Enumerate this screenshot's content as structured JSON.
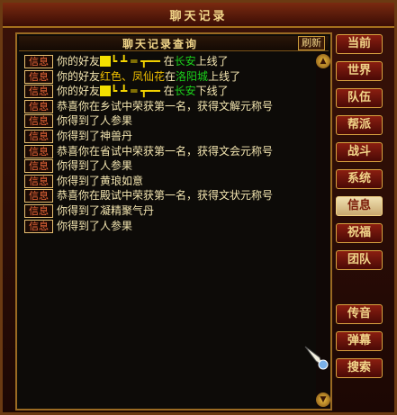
{
  "window": {
    "title": "聊天记录"
  },
  "query": {
    "title": "聊天记录查询",
    "refresh_label": "刷新"
  },
  "colors": {
    "accent": "#d8a240",
    "tag": "#f06a3a",
    "text": "#f3e5b0",
    "place": "#1bd11b",
    "name": "#f0c000"
  },
  "messages": [
    {
      "tag": "信息",
      "parts": [
        {
          "t": "你的好友"
        },
        {
          "icon": "name-glyph-icon"
        },
        {
          "t": "┗ ┻ ═ ┳━━ ",
          "c": "c-yellow"
        },
        {
          "t": "在"
        },
        {
          "t": "长安",
          "c": "c-green"
        },
        {
          "t": "上线了"
        }
      ]
    },
    {
      "tag": "信息",
      "parts": [
        {
          "t": "你的好友"
        },
        {
          "t": "红色、凤仙花",
          "c": "c-gold"
        },
        {
          "t": "在"
        },
        {
          "t": "洛阳城",
          "c": "c-green"
        },
        {
          "t": "上线了"
        }
      ]
    },
    {
      "tag": "信息",
      "parts": [
        {
          "t": "你的好友"
        },
        {
          "icon": "name-glyph-icon"
        },
        {
          "t": "┗ ┻ ═ ┳━━ ",
          "c": "c-yellow"
        },
        {
          "t": "在"
        },
        {
          "t": "长安",
          "c": "c-green"
        },
        {
          "t": "下线了"
        }
      ]
    },
    {
      "tag": "信息",
      "parts": [
        {
          "t": "恭喜你在乡试中荣获第一名，获得文解元称号"
        }
      ]
    },
    {
      "tag": "信息",
      "parts": [
        {
          "t": "你得到了人参果"
        }
      ]
    },
    {
      "tag": "信息",
      "parts": [
        {
          "t": "你得到了神兽丹"
        }
      ]
    },
    {
      "tag": "信息",
      "parts": [
        {
          "t": "恭喜你在省试中荣获第一名，获得文会元称号"
        }
      ]
    },
    {
      "tag": "信息",
      "parts": [
        {
          "t": "你得到了人参果"
        }
      ]
    },
    {
      "tag": "信息",
      "parts": [
        {
          "t": "你得到了黄琅如意"
        }
      ]
    },
    {
      "tag": "信息",
      "parts": [
        {
          "t": "恭喜你在殿试中荣获第一名，获得文状元称号"
        }
      ]
    },
    {
      "tag": "信息",
      "parts": [
        {
          "t": "你得到了凝精聚气丹"
        }
      ]
    },
    {
      "tag": "信息",
      "parts": [
        {
          "t": "你得到了人参果"
        }
      ]
    }
  ],
  "side_buttons": [
    {
      "label": "当前",
      "name": "tab-current",
      "active": false
    },
    {
      "label": "世界",
      "name": "tab-world",
      "active": false
    },
    {
      "label": "队伍",
      "name": "tab-team",
      "active": false
    },
    {
      "label": "帮派",
      "name": "tab-guild",
      "active": false
    },
    {
      "label": "战斗",
      "name": "tab-battle",
      "active": false
    },
    {
      "label": "系统",
      "name": "tab-system",
      "active": false
    },
    {
      "label": "信息",
      "name": "tab-info",
      "active": true
    },
    {
      "label": "祝福",
      "name": "tab-blessing",
      "active": false
    },
    {
      "label": "团队",
      "name": "tab-group",
      "active": false
    },
    {
      "label": "传音",
      "name": "transmit-button",
      "active": false
    },
    {
      "label": "弹幕",
      "name": "danmaku-button",
      "active": false
    },
    {
      "label": "搜索",
      "name": "search-button",
      "active": false
    }
  ]
}
